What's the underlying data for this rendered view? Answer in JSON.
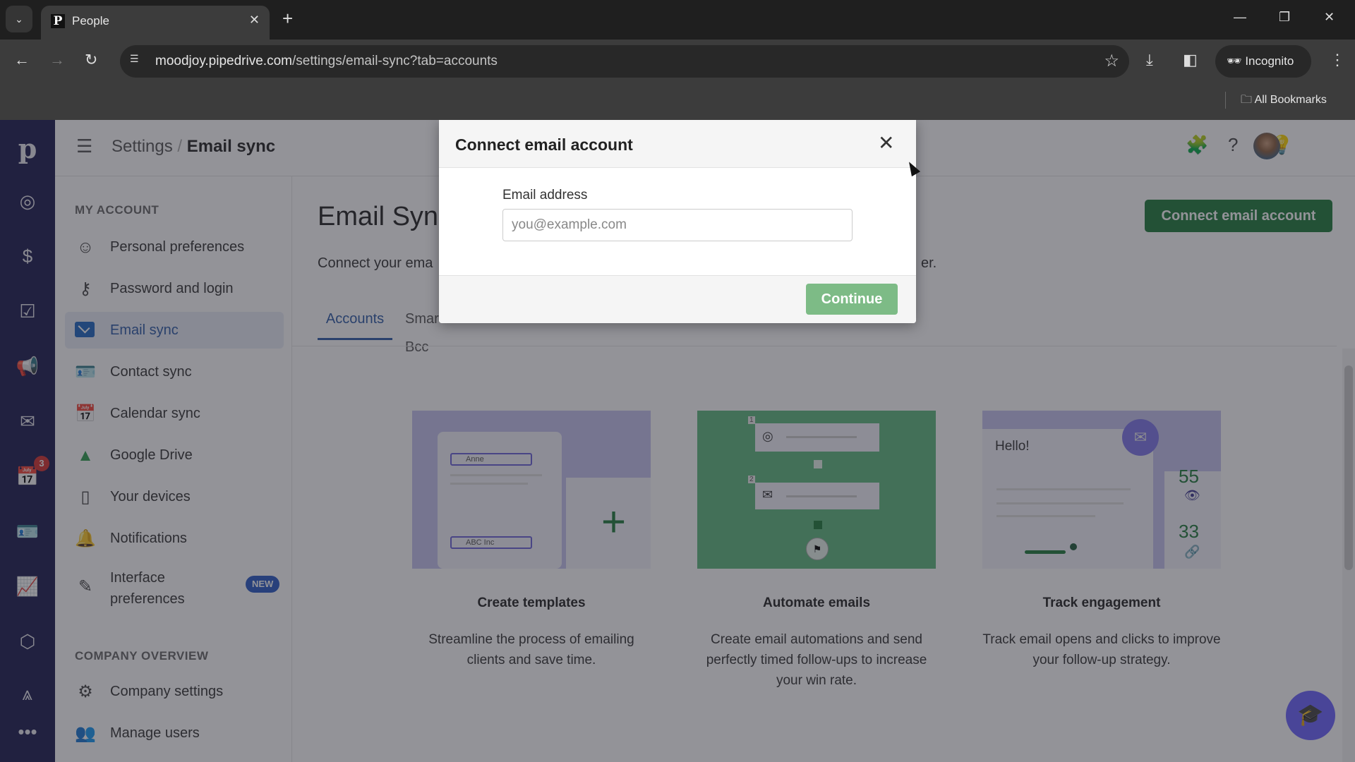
{
  "browser": {
    "tab_title": "People",
    "tab_favicon": "P",
    "url_host": "moodjoy.pipedrive.com",
    "url_path": "/settings/email-sync?tab=accounts",
    "incognito_label": "Incognito",
    "bookmarks_label": "All Bookmarks"
  },
  "rail": {
    "logo": "p",
    "items": [
      {
        "icon": "leads-target-icon"
      },
      {
        "icon": "deals-dollar-icon"
      },
      {
        "icon": "activities-clipboard-icon"
      },
      {
        "icon": "campaigns-megaphone-icon"
      },
      {
        "icon": "mail-icon"
      },
      {
        "icon": "calendar-icon",
        "badge": "3"
      },
      {
        "icon": "contacts-card-icon"
      },
      {
        "icon": "insights-chart-icon"
      },
      {
        "icon": "products-box-icon"
      },
      {
        "icon": "marketplace-icon"
      },
      {
        "icon": "more-icon"
      }
    ]
  },
  "header": {
    "breadcrumb_parent": "Settings",
    "breadcrumb_sep": "/",
    "breadcrumb_current": "Email sync"
  },
  "settings_nav": {
    "my_account_title": "MY ACCOUNT",
    "items": [
      {
        "label": "Personal preferences"
      },
      {
        "label": "Password and login"
      },
      {
        "label": "Email sync",
        "active": true
      },
      {
        "label": "Contact sync"
      },
      {
        "label": "Calendar sync"
      },
      {
        "label": "Google Drive"
      },
      {
        "label": "Your devices"
      },
      {
        "label": "Notifications"
      },
      {
        "label": "Interface preferences",
        "badge": "NEW"
      }
    ],
    "company_title": "COMPANY OVERVIEW",
    "company_items": [
      {
        "label": "Company settings"
      },
      {
        "label": "Manage users"
      }
    ]
  },
  "main": {
    "title": "Email Sync",
    "description_visible_start": "Connect your ema",
    "description_visible_end": "er.",
    "connect_button": "Connect email account",
    "tabs": [
      {
        "label": "Accounts",
        "active": true
      },
      {
        "label": "Smart Bcc"
      }
    ],
    "cards": [
      {
        "title": "Create templates",
        "desc": "Streamline the process of emailing clients and save time.",
        "img_field1": "Anne",
        "img_field2": "ABC Inc"
      },
      {
        "title": "Automate emails",
        "desc": "Create email automations and send perfectly timed follow-ups to increase your win rate.",
        "step1": "1",
        "step2": "2"
      },
      {
        "title": "Track engagement",
        "desc": "Track email opens and clicks to improve your follow-up strategy.",
        "img_greeting": "Hello!",
        "opens": "55",
        "clicks": "33"
      }
    ]
  },
  "modal": {
    "title": "Connect email account",
    "field_label": "Email address",
    "field_value": "",
    "field_placeholder": "you@example.com",
    "continue_label": "Continue"
  }
}
